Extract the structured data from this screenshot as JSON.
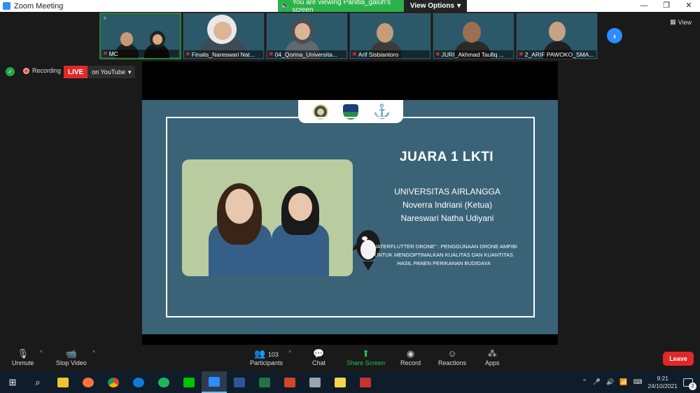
{
  "window": {
    "title": "Zoom Meeting",
    "controls": [
      "—",
      "❐",
      "✕"
    ]
  },
  "view_banner": {
    "text": "You are viewing Panitia_galuh's screen",
    "options_label": "View Options"
  },
  "top_right": {
    "view_label": "View"
  },
  "participants_strip": [
    {
      "name": "MC",
      "active": true
    },
    {
      "name": "Finalis_Nareswari Nat..."
    },
    {
      "name": "04_Qorina_Universita..."
    },
    {
      "name": "Arif Sisbiantoro"
    },
    {
      "name": "JURI_Akhmad Taufiq ..."
    },
    {
      "name": "2_ARIF PAWOKO_SMA..."
    }
  ],
  "status": {
    "recording_label": "Recording",
    "live_label": "LIVE",
    "youtube_label": "on YouTube"
  },
  "slide": {
    "heading": "JUARA 1 LKTI",
    "university": "UNIVERSITAS AIRLANGGA",
    "member1": "Noverra Indriani  (Ketua)",
    "member2": "Nareswari Natha Udiyani",
    "description": "\"WATERFLUTTER DRONE\" : PENGGUNAAN DRONE AMFIBI UNTUK MENGOPTIMALKAN KUALITAS DAN KUANTITAS HASIL PANEN PERIKANAN BUDIDAYA"
  },
  "toolbar": {
    "unmute": "Unmute",
    "stop_video": "Stop Video",
    "participants": "Participants",
    "participants_count": "103",
    "chat": "Chat",
    "share_screen": "Share Screen",
    "record": "Record",
    "reactions": "Reactions",
    "apps": "Apps",
    "leave": "Leave"
  },
  "taskbar": {
    "time": "9:21",
    "date": "24/10/2021",
    "notification_count": "2"
  }
}
